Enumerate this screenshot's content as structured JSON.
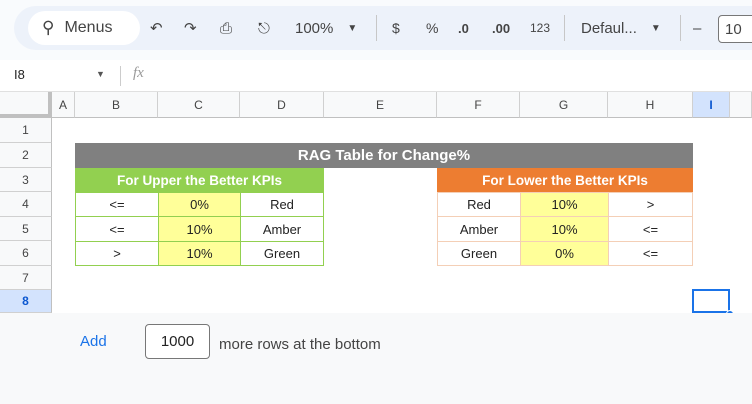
{
  "toolbar": {
    "search_label": "Menus",
    "zoom": "100%",
    "currency": "$",
    "percent": "%",
    "dec_decrease": ".0",
    "dec_increase": ".00",
    "format_more": "123",
    "font": "Defaul...",
    "minus": "–",
    "font_size": "10"
  },
  "formula_bar": {
    "name_box": "I8",
    "fx": "fx",
    "value": ""
  },
  "columns": [
    "A",
    "B",
    "C",
    "D",
    "E",
    "F",
    "G",
    "H",
    "I"
  ],
  "rows": [
    "1",
    "2",
    "3",
    "4",
    "5",
    "6",
    "7",
    "8"
  ],
  "selected_cell": "I8",
  "table": {
    "title": "RAG Table for Change%",
    "upper": {
      "header": "For Upper the Better KPIs",
      "rows": [
        [
          "<=",
          "0%",
          "Red"
        ],
        [
          "<=",
          "10%",
          "Amber"
        ],
        [
          ">",
          "10%",
          "Green"
        ]
      ]
    },
    "lower": {
      "header": "For Lower the Better KPIs",
      "rows": [
        [
          "Red",
          "10%",
          ">"
        ],
        [
          "Amber",
          "10%",
          "<="
        ],
        [
          "Green",
          "0%",
          "<="
        ]
      ]
    }
  },
  "colors": {
    "title_bg": "#808080",
    "upper_header": "#92d050",
    "lower_header": "#ed7d31",
    "value_fill": "#ffff99"
  },
  "footer": {
    "add_label": "Add",
    "rows_value": "1000",
    "suffix": "more rows at the bottom"
  }
}
